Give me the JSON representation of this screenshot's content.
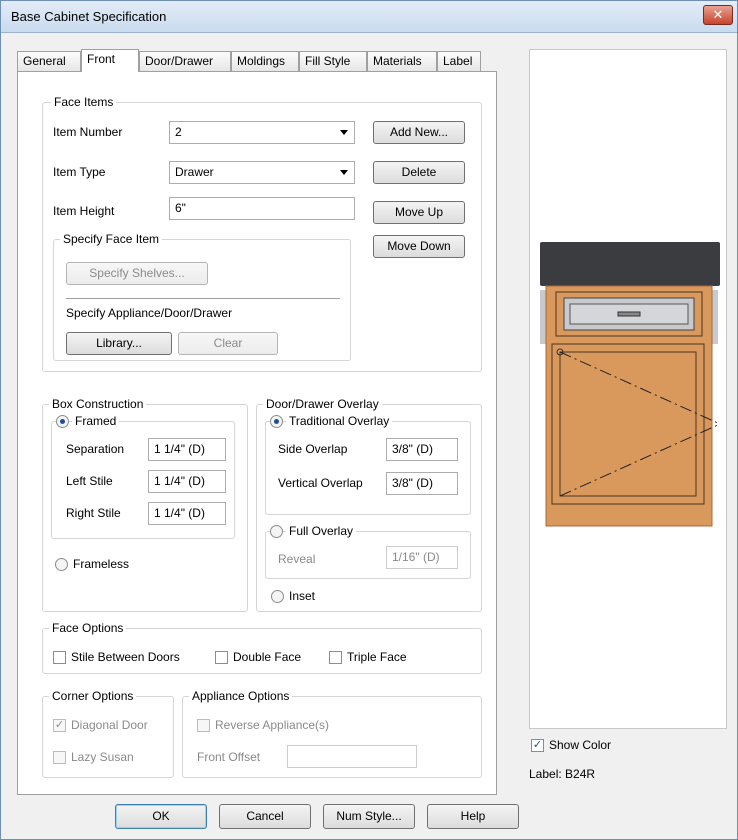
{
  "window": {
    "title": "Base Cabinet Specification",
    "close_glyph": "✕"
  },
  "tabs": [
    "General",
    "Front",
    "Door/Drawer",
    "Moldings",
    "Fill Style",
    "Materials",
    "Label"
  ],
  "face_items": {
    "legend": "Face Items",
    "item_number_label": "Item Number",
    "item_number_value": "2",
    "item_type_label": "Item Type",
    "item_type_value": "Drawer",
    "item_height_label": "Item Height",
    "item_height_value": "6\"",
    "add_new": "Add New...",
    "delete": "Delete",
    "move_up": "Move Up",
    "move_down": "Move Down",
    "specify_face_item": {
      "legend": "Specify Face Item",
      "specify_shelves": "Specify Shelves...",
      "appliance_label": "Specify Appliance/Door/Drawer",
      "library": "Library...",
      "clear": "Clear"
    }
  },
  "box_construction": {
    "legend": "Box Construction",
    "framed": "Framed",
    "separation_label": "Separation",
    "separation_value": "1 1/4\" (D)",
    "left_stile_label": "Left Stile",
    "left_stile_value": "1 1/4\" (D)",
    "right_stile_label": "Right Stile",
    "right_stile_value": "1 1/4\" (D)",
    "frameless": "Frameless"
  },
  "overlay": {
    "legend": "Door/Drawer Overlay",
    "traditional": "Traditional Overlay",
    "side_overlap_label": "Side Overlap",
    "side_overlap_value": "3/8\" (D)",
    "vertical_overlap_label": "Vertical Overlap",
    "vertical_overlap_value": "3/8\" (D)",
    "full_overlay": "Full Overlay",
    "reveal_label": "Reveal",
    "reveal_value": "1/16\" (D)",
    "inset": "Inset"
  },
  "face_options": {
    "legend": "Face Options",
    "stile_between_doors": "Stile Between Doors",
    "double_face": "Double Face",
    "triple_face": "Triple Face"
  },
  "corner_options": {
    "legend": "Corner Options",
    "diagonal_door": "Diagonal Door",
    "lazy_susan": "Lazy Susan"
  },
  "appliance_options": {
    "legend": "Appliance Options",
    "reverse_appliance": "Reverse Appliance(s)",
    "front_offset_label": "Front Offset",
    "front_offset_value": ""
  },
  "preview": {
    "show_color": "Show Color",
    "label_text": "Label:  B24R",
    "colors": {
      "countertop": "#3a3c40",
      "wood": "#d9995c",
      "wood_dark": "#a8683a",
      "steel": "#c7c9cc"
    }
  },
  "footer": {
    "ok": "OK",
    "cancel": "Cancel",
    "num_style": "Num Style...",
    "help": "Help"
  },
  "glyphs": {
    "checkmark": "✓"
  }
}
